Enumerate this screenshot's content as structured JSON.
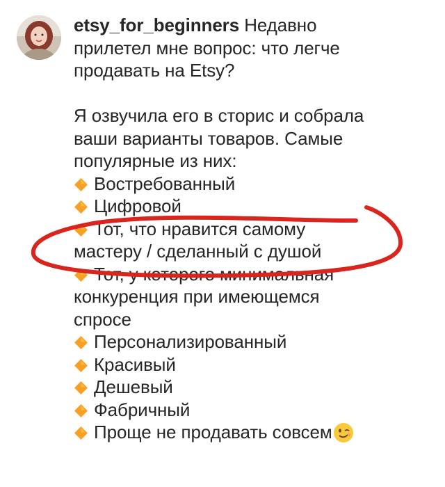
{
  "post": {
    "username": "etsy_for_beginners",
    "intro_line1_rest": "Недавно",
    "intro_line2": "прилетел мне вопрос: что легче",
    "intro_line3": "продавать на Etsy?",
    "para_line1": "Я озвучила его в сторис и собрала",
    "para_line2": "ваши варианты товаров. Самые",
    "para_line3": "популярные из них:",
    "bullet_icon": "orange-diamond-icon",
    "items": [
      {
        "lines": [
          "Востребованный"
        ]
      },
      {
        "lines": [
          "Цифровой"
        ]
      },
      {
        "lines": [
          "Тот, что нравится самому",
          "мастеру / сделанный с душой"
        ]
      },
      {
        "lines": [
          "Тот, у которого минимальная",
          "конкуренция при имеющемся",
          "спросе"
        ]
      },
      {
        "lines": [
          "Персонализированный"
        ]
      },
      {
        "lines": [
          "Красивый"
        ]
      },
      {
        "lines": [
          "Дешевый"
        ]
      },
      {
        "lines": [
          "Фабричный"
        ]
      },
      {
        "lines": [
          "Проще не продавать совсем"
        ]
      }
    ],
    "final_emoji": "winking-face-icon",
    "annotation_color": "#d8261f",
    "bullet_color": "#f7a021"
  }
}
